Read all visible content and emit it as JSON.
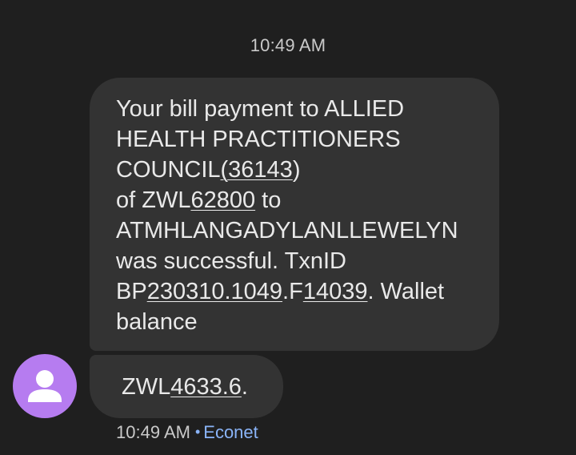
{
  "conversation": {
    "timestamp_header": "10:49 AM",
    "message": {
      "lines": [
        {
          "parts": [
            {
              "text": "Your bill payment to ALLIED",
              "link": false
            }
          ]
        },
        {
          "parts": [
            {
              "text": "HEALTH PRACTITIONERS",
              "link": false
            }
          ]
        },
        {
          "parts": [
            {
              "text": "COUNCIL",
              "link": false
            },
            {
              "text": "(36143",
              "link": true
            },
            {
              "text": ")",
              "link": false
            }
          ]
        },
        {
          "parts": [
            {
              "text": "of ZWL",
              "link": false
            },
            {
              "text": "62800",
              "link": true
            },
            {
              "text": " to",
              "link": false
            }
          ]
        },
        {
          "parts": [
            {
              "text": "ATMHLANGADYLANLLEWELYN",
              "link": false
            }
          ]
        },
        {
          "parts": [
            {
              "text": "was successful. TxnID",
              "link": false
            }
          ]
        },
        {
          "parts": [
            {
              "text": "BP",
              "link": false
            },
            {
              "text": "230310.1049",
              "link": true
            },
            {
              "text": ".F",
              "link": false
            },
            {
              "text": "14039",
              "link": true
            },
            {
              "text": ". Wallet",
              "link": false
            }
          ]
        },
        {
          "parts": [
            {
              "text": "balance",
              "link": false
            }
          ]
        }
      ],
      "continuation": {
        "prefix": "ZWL",
        "amount": "4633.6",
        "suffix": "."
      }
    },
    "footer": {
      "time": "10:49 AM",
      "separator": "•",
      "carrier": "Econet"
    },
    "avatar": {
      "icon": "person-icon",
      "color": "#b67cf0"
    },
    "colors": {
      "background": "#1f1f1f",
      "bubble": "#333333",
      "accent": "#8ab4f8"
    }
  }
}
